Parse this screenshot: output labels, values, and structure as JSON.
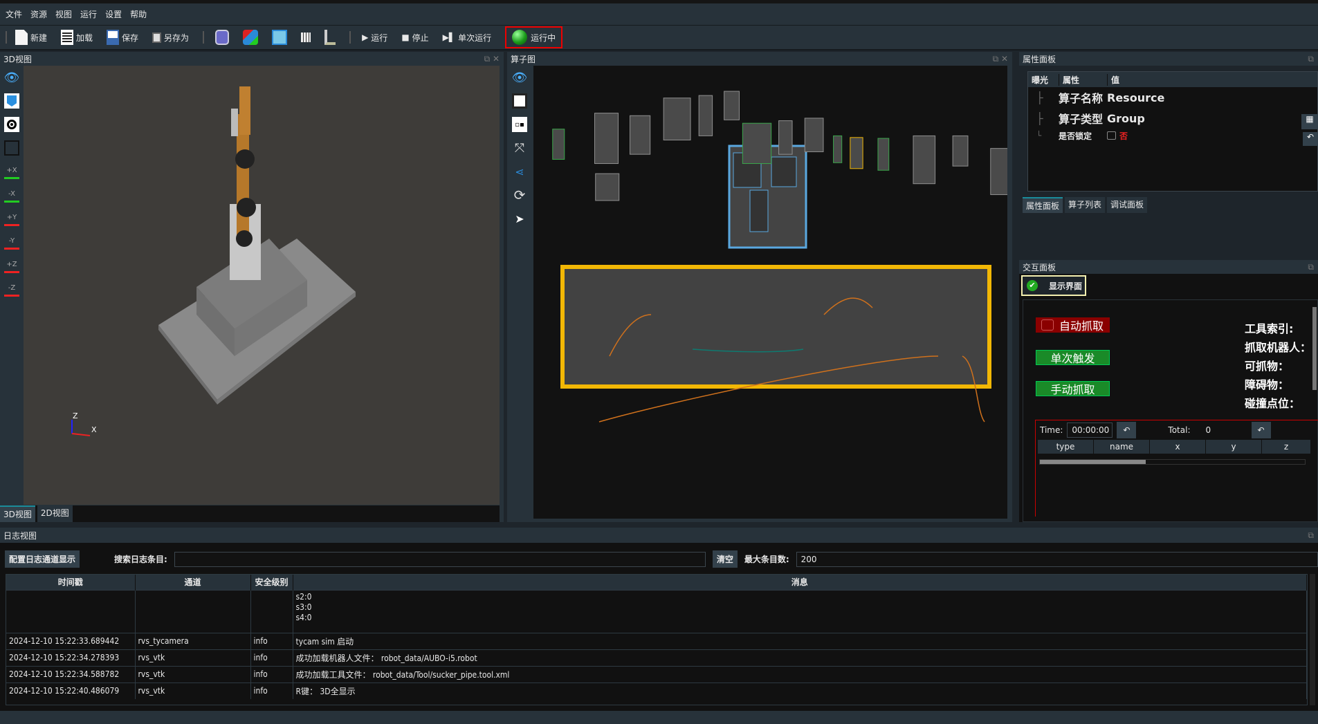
{
  "menu": [
    "文件",
    "资源",
    "视图",
    "运行",
    "设置",
    "帮助"
  ],
  "toolbar": {
    "new": "新建",
    "load": "加载",
    "save": "保存",
    "save_as": "另存为",
    "run": "运行",
    "stop": "停止",
    "single_run": "单次运行",
    "status": "运行中",
    "icons": [
      "magnifier-icon",
      "shapes-icon",
      "blueprint-icon",
      "table-icon",
      "robot-arm-icon"
    ]
  },
  "view3d": {
    "title": "3D视图",
    "tabs": [
      "3D视图",
      "2D视图"
    ],
    "active_tab": "3D视图",
    "axis_z": "Z",
    "axis_x": "X",
    "side_icons": [
      "eye-icon",
      "cube-icon",
      "target-icon",
      "screenshot-icon",
      "view-plus-x-icon",
      "view-minus-x-icon",
      "view-plus-y-icon",
      "view-minus-y-icon",
      "view-plus-z-icon",
      "view-minus-z-icon"
    ],
    "axis_buttons": [
      "+X",
      "-X",
      "+Y",
      "-Y",
      "+Z",
      "-Z"
    ]
  },
  "graph": {
    "title": "算子图",
    "side_icons": [
      "eye-icon",
      "group-icon",
      "ungroup-icon",
      "fit-icon",
      "connect-icon",
      "refresh-icon",
      "pointer-icon"
    ],
    "colors": {
      "group": "#f2b705",
      "node": "#8f8f8f",
      "start": "#3aa64a",
      "wire_orange": "#d0711c",
      "wire_teal": "#0e7a70"
    }
  },
  "props": {
    "title": "属性面板",
    "columns": [
      "曝光",
      "属性",
      "值"
    ],
    "rows": [
      {
        "key": "算子名称",
        "value": "Resource"
      },
      {
        "key": "算子类型",
        "value": "Group"
      },
      {
        "key": "是否锁定",
        "value": "否",
        "checked": false
      }
    ],
    "tabs": [
      "属性面板",
      "算子列表",
      "调试面板"
    ],
    "active_tab": "属性面板"
  },
  "interact": {
    "title": "交互面板",
    "show_ui": "显示界面",
    "auto_grab": "自动抓取",
    "auto_grab_checked": false,
    "single_trigger": "单次触发",
    "manual_grab": "手动抓取",
    "labels": [
      "工具索引:",
      "抓取机器人：",
      "可抓物：",
      "障碍物：",
      "碰撞点位："
    ],
    "time_label": "Time:",
    "time_value": "00:00:00",
    "total_label": "Total:",
    "total_value": "0",
    "columns": [
      "type",
      "name",
      "x",
      "y",
      "z"
    ]
  },
  "log": {
    "title": "日志视图",
    "config_button": "配置日志通道显示",
    "search_label": "搜索日志条目:",
    "search_value": "",
    "clear_button": "清空",
    "max_label": "最大条目数:",
    "max_value": "200",
    "columns": [
      "时间戳",
      "通道",
      "安全级别",
      "消息"
    ],
    "rows": [
      {
        "time": "",
        "channel": "",
        "level": "",
        "message": "s2:0\ns3:0\ns4:0"
      },
      {
        "time": "2024-12-10 15:22:33.689442",
        "channel": "rvs_tycamera",
        "level": "info",
        "message": "tycam sim 启动"
      },
      {
        "time": "2024-12-10 15:22:34.278393",
        "channel": "rvs_vtk",
        "level": "info",
        "message": "成功加载机器人文件： robot_data/AUBO-i5.robot"
      },
      {
        "time": "2024-12-10 15:22:34.588782",
        "channel": "rvs_vtk",
        "level": "info",
        "message": "成功加载工具文件： robot_data/Tool/sucker_pipe.tool.xml"
      },
      {
        "time": "2024-12-10 15:22:40.486079",
        "channel": "rvs_vtk",
        "level": "info",
        "message": "R键： 3D全显示"
      }
    ]
  }
}
